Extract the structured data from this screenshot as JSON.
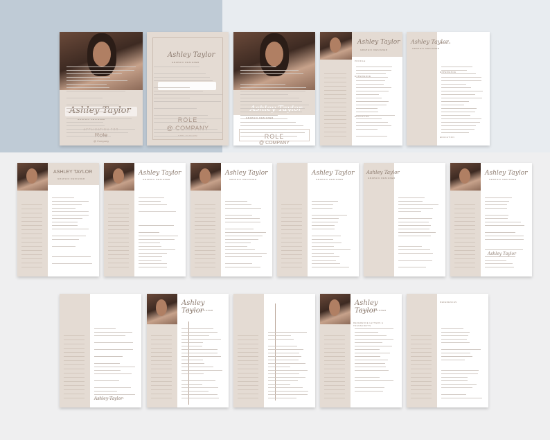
{
  "name_script": "Ashley Taylor",
  "name_caps": "ASHLEY TAYLOR",
  "role_title": "GRAPHIC DESIGNER",
  "cover": {
    "application_for": "APPLICATION FOR",
    "role": "Role",
    "at_company": "@ Company",
    "role_caps": "ROLE",
    "at_company_caps": "@ COMPANY",
    "application": "APPLICATION",
    "application_title": "Application"
  },
  "sections": {
    "profile": "PROFILE",
    "experience": "EXPERIENCE",
    "education": "EDUCATION",
    "skills": "SKILLS",
    "interests": "INTERESTS",
    "languages": "LANGUAGES",
    "references": "REFERENCES",
    "references_letter": "REFERENCE LETTERS & TRANSCRIPTS"
  },
  "signature": "Ashley Taylor",
  "colors": {
    "beige": "#e4dbd3",
    "accent": "#8d7c70"
  }
}
